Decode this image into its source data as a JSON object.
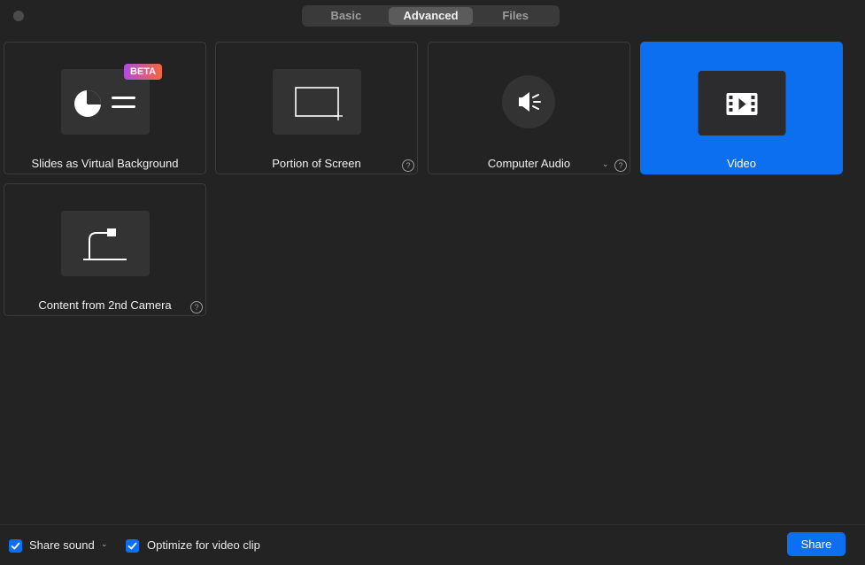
{
  "tabs": [
    {
      "label": "Basic"
    },
    {
      "label": "Advanced"
    },
    {
      "label": "Files"
    }
  ],
  "tiles": [
    {
      "label": "Slides as Virtual Background",
      "badge": "BETA",
      "icon": "slides-icon"
    },
    {
      "label": "Portion of Screen",
      "icon": "portion-screen-icon"
    },
    {
      "label": "Computer Audio",
      "icon": "speaker-icon"
    },
    {
      "label": "Video",
      "icon": "video-icon",
      "selected": true
    },
    {
      "label": "Content from 2nd Camera",
      "icon": "document-camera-icon"
    }
  ],
  "help_glyph": "?",
  "options": {
    "share_sound": {
      "label": "Share sound",
      "checked": true
    },
    "optimize_video": {
      "label": "Optimize for video clip",
      "checked": true
    }
  },
  "share_button": {
    "label": "Share"
  },
  "colors": {
    "accent": "#0b6ff0",
    "background": "#232323"
  }
}
